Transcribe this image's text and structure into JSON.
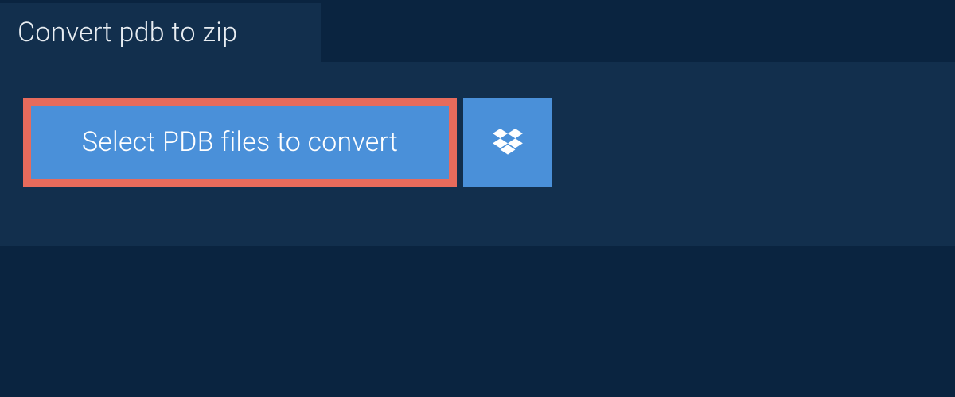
{
  "tab": {
    "label": "Convert pdb to zip"
  },
  "actions": {
    "select_label": "Select PDB files to convert"
  },
  "colors": {
    "background": "#0a2440",
    "panel": "#122f4d",
    "button": "#4a90d9",
    "highlight_border": "#e76b5c",
    "text_light": "#e8edf2",
    "text_white": "#ffffff"
  }
}
